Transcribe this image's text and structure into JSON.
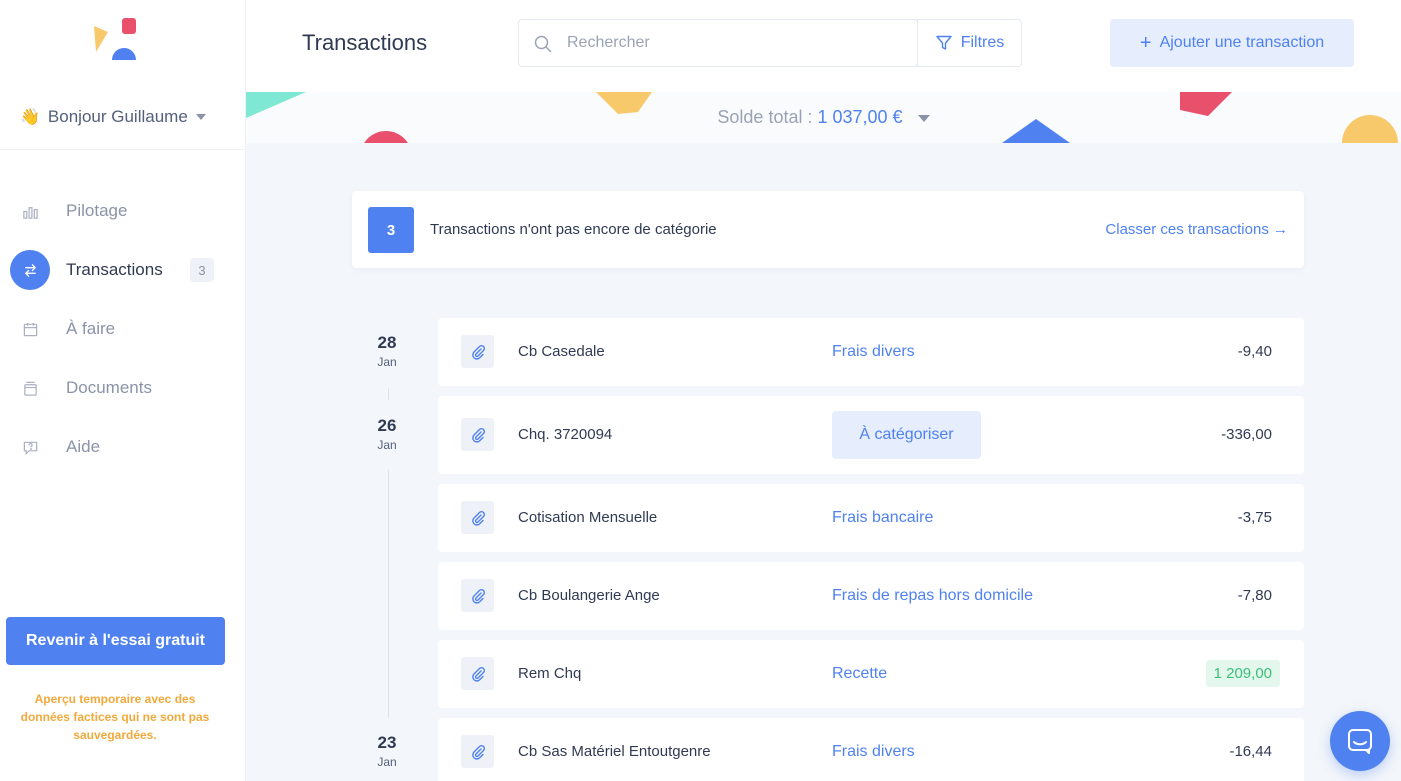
{
  "app": {
    "brand_colors": {
      "blue": "#4f82f0",
      "yellow": "#f7c96b",
      "red": "#e8506b",
      "green": "#3bbf7a"
    }
  },
  "sidebar": {
    "greeting": {
      "emoji": "👋",
      "text": "Bonjour Guillaume"
    },
    "items": [
      {
        "label": "Pilotage",
        "icon": "bar-chart-icon",
        "active": false
      },
      {
        "label": "Transactions",
        "icon": "transfer-arrows-icon",
        "active": true,
        "badge": "3"
      },
      {
        "label": "À faire",
        "icon": "calendar-icon",
        "active": false
      },
      {
        "label": "Documents",
        "icon": "archive-box-icon",
        "active": false
      },
      {
        "label": "Aide",
        "icon": "help-chat-icon",
        "active": false
      }
    ],
    "trial_button": "Revenir à l'essai gratuit",
    "trial_note": "Aperçu temporaire avec des données factices qui ne sont pas sauvegardées."
  },
  "header": {
    "title": "Transactions",
    "search_placeholder": "Rechercher",
    "filters_label": "Filtres",
    "add_label": "Ajouter une transaction"
  },
  "balance": {
    "label": "Solde total :",
    "amount": "1 037,00 €"
  },
  "alert": {
    "count": "3",
    "text": "Transactions n'ont pas encore de catégorie",
    "link": "Classer ces transactions →"
  },
  "dates": [
    {
      "day": "28",
      "month": "Jan"
    },
    {
      "day": "26",
      "month": "Jan"
    },
    {
      "day": "23",
      "month": "Jan"
    }
  ],
  "transactions": [
    {
      "label": "Cb Casedale",
      "category": "Frais divers",
      "amount": "-9,40",
      "uncategorized": false,
      "positive": false
    },
    {
      "label": "Chq. 3720094",
      "category": "À catégoriser",
      "amount": "-336,00",
      "uncategorized": true,
      "positive": false
    },
    {
      "label": "Cotisation Mensuelle",
      "category": "Frais bancaire",
      "amount": "-3,75",
      "uncategorized": false,
      "positive": false
    },
    {
      "label": "Cb Boulangerie Ange",
      "category": "Frais de repas hors domicile",
      "amount": "-7,80",
      "uncategorized": false,
      "positive": false
    },
    {
      "label": "Rem Chq",
      "category": "Recette",
      "amount": "1 209,00",
      "uncategorized": false,
      "positive": true
    },
    {
      "label": "Cb Sas Matériel Entoutgenre",
      "category": "Frais divers",
      "amount": "-16,44",
      "uncategorized": false,
      "positive": false
    }
  ]
}
